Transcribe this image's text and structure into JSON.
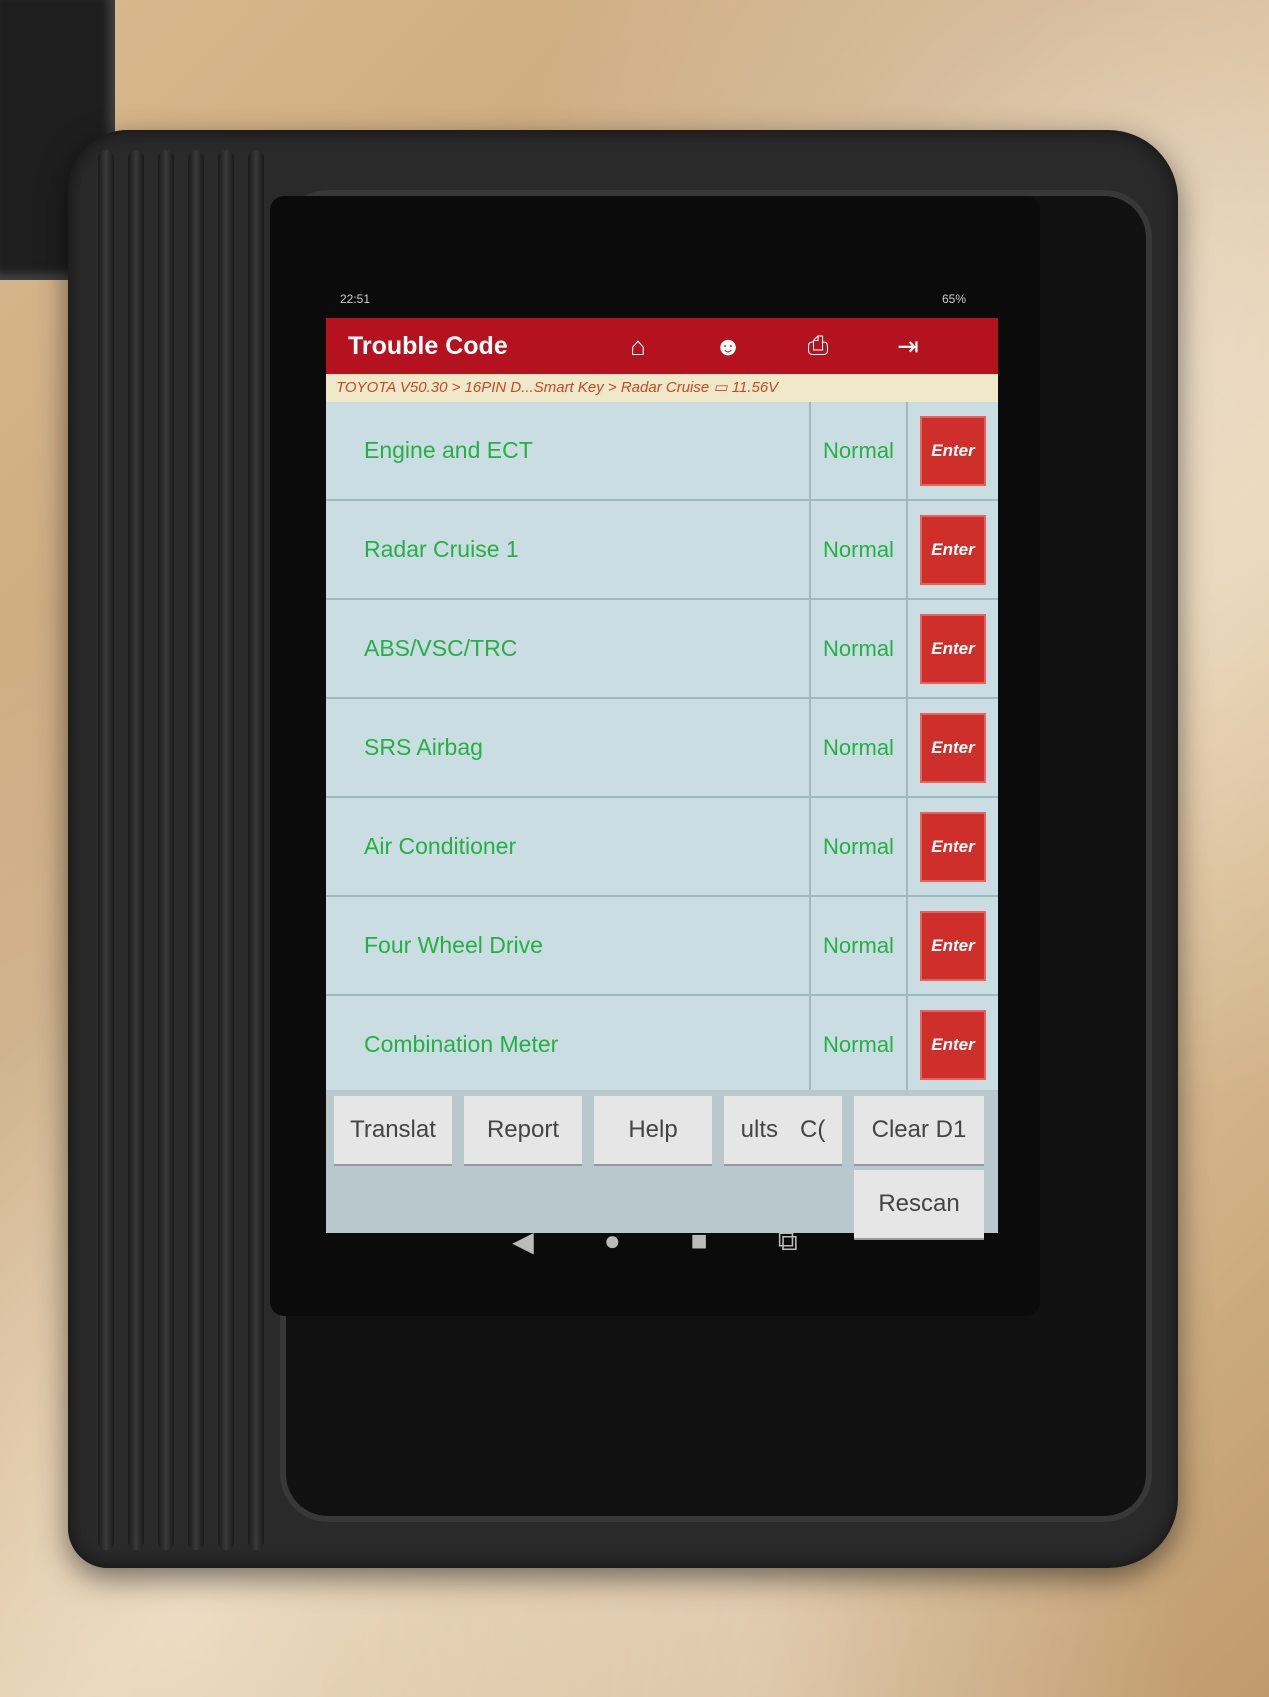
{
  "status": {
    "time": "22:51",
    "battery": "65%"
  },
  "header": {
    "title": "Trouble Code"
  },
  "breadcrumb": "TOYOTA V50.30 > 16PIN D...Smart Key > Radar Cruise",
  "voltage": "11.56V",
  "systems": [
    {
      "name": "Engine and ECT",
      "status": "Normal",
      "action": "Enter"
    },
    {
      "name": "Radar Cruise 1",
      "status": "Normal",
      "action": "Enter"
    },
    {
      "name": "ABS/VSC/TRC",
      "status": "Normal",
      "action": "Enter"
    },
    {
      "name": "SRS Airbag",
      "status": "Normal",
      "action": "Enter"
    },
    {
      "name": "Air Conditioner",
      "status": "Normal",
      "action": "Enter"
    },
    {
      "name": "Four Wheel Drive",
      "status": "Normal",
      "action": "Enter"
    },
    {
      "name": "Combination Meter",
      "status": "Normal",
      "action": "Enter"
    }
  ],
  "toolbar": {
    "translate": "Translat",
    "report": "Report",
    "help": "Help",
    "results": "ults",
    "clear_partial": "C(",
    "clear_dtc": "Clear D1",
    "rescan": "Rescan"
  },
  "colors": {
    "header": "#b3121e",
    "normal_text": "#25b043",
    "enter_button": "#cf2f2a"
  }
}
